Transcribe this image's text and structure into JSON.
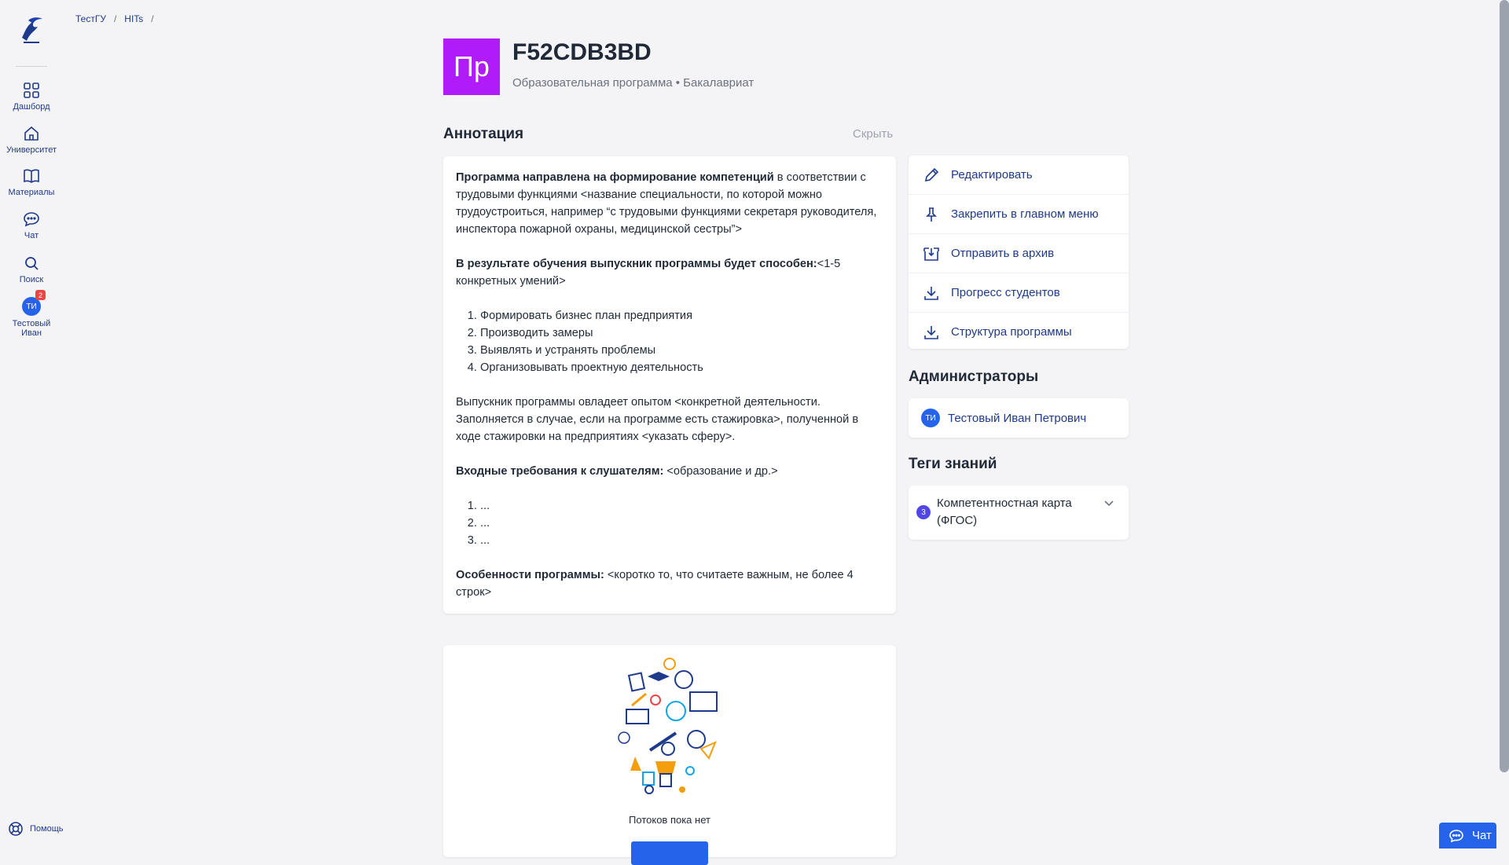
{
  "sidebar": {
    "items": [
      {
        "label": "Дашборд",
        "icon": "grid-icon"
      },
      {
        "label": "Университет",
        "icon": "home-icon"
      },
      {
        "label": "Материалы",
        "icon": "book-icon"
      },
      {
        "label": "Чат",
        "icon": "chat-icon"
      },
      {
        "label": "Поиск",
        "icon": "search-icon"
      }
    ],
    "user": {
      "initials": "ТИ",
      "badge": "2",
      "name_line1": "Тестовый",
      "name_line2": "Иван"
    },
    "help_label": "Помощь"
  },
  "breadcrumb": {
    "items": [
      "ТестГУ",
      "HITs"
    ],
    "separator": "/"
  },
  "program": {
    "avatar": "Пр",
    "avatar_color": "#b01bfa",
    "title": "F52CDB3BD",
    "subtitle": "Образовательная программа • Бакалавриат"
  },
  "annotation": {
    "title": "Аннотация",
    "hide_label": "Скрыть",
    "p1_bold": "Программа направлена на формирование компетенций",
    "p1_rest": " в соответствии с трудовыми функциями <название специальности, по которой можно трудоустроиться, например “с трудовыми функциями секретаря руководителя, инспектора пожарной охраны, медицинской сестры”>",
    "p2_bold": "В результате обучения выпускник программы будет способен:",
    "p2_rest": "<1-5 конкретных умений>",
    "skills": [
      "Формировать бизнес план предприятия",
      "Производить замеры",
      "Выявлять и устранять проблемы",
      "Организовывать проектную деятельность"
    ],
    "p3": "Выпускник программы овладеет опытом <конкретной деятельности. Заполняется в случае, если на программе есть стажировка>, полученной в ходе стажировки на предприятиях <указать сферу>.",
    "p4_bold": "Входные требования к слушателям:",
    "p4_rest": " <образование и др.>",
    "requirements": [
      "...",
      "...",
      "..."
    ],
    "p5_bold": "Особенности программы:",
    "p5_rest": " <коротко то, что считаете важным, не более 4 строк>"
  },
  "actions": [
    {
      "label": "Редактировать",
      "icon": "pencil-icon"
    },
    {
      "label": "Закрепить в главном меню",
      "icon": "pin-icon"
    },
    {
      "label": "Отправить в архив",
      "icon": "archive-icon"
    },
    {
      "label": "Прогресс студентов",
      "icon": "download-icon"
    },
    {
      "label": "Структура программы",
      "icon": "download-icon"
    }
  ],
  "admins": {
    "title": "Администраторы",
    "items": [
      {
        "initials": "ТИ",
        "name": "Тестовый Иван Петрович"
      }
    ]
  },
  "tags": {
    "title": "Теги знаний",
    "items": [
      {
        "count": "3",
        "label": "Компетентностная карта (ФГОС)"
      }
    ]
  },
  "streams": {
    "empty_text": "Потоков пока нет"
  },
  "chat_button": {
    "label": "Чат"
  },
  "colors": {
    "accent": "#2563eb",
    "link": "#1e3a8a",
    "background": "#f4f4f7"
  }
}
